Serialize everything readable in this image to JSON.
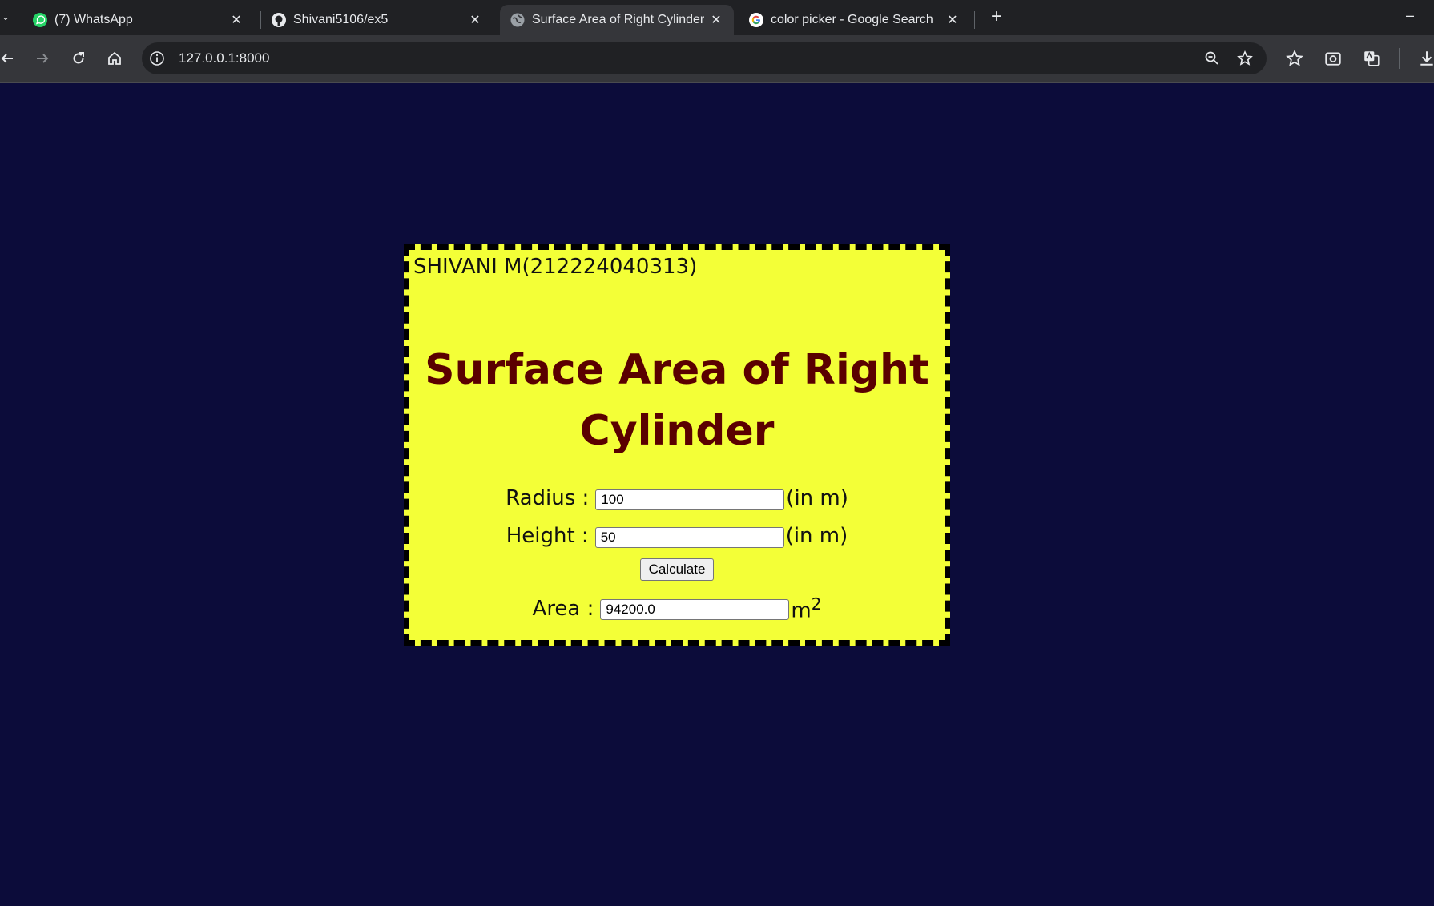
{
  "browser": {
    "tabs": [
      {
        "title": "(7) WhatsApp",
        "icon": "whatsapp-icon",
        "active": false
      },
      {
        "title": "Shivani5106/ex5",
        "icon": "github-icon",
        "active": false
      },
      {
        "title": "Surface Area of Right Cylinder",
        "icon": "globe-icon",
        "active": true
      },
      {
        "title": "color picker - Google Search",
        "icon": "google-icon",
        "active": false
      }
    ],
    "new_tab_label": "+",
    "minimize_label": "–",
    "close_glyph": "✕",
    "url": "127.0.0.1:8000"
  },
  "page": {
    "author": "SHIVANI M(212224040313)",
    "title": "Surface Area of Right Cylinder",
    "radius_label": "Radius :",
    "radius_value": "100",
    "radius_unit": "(in m)",
    "height_label": "Height :",
    "height_value": "50",
    "height_unit": "(in m)",
    "calculate_label": "Calculate",
    "area_label": "Area :",
    "area_value": "94200.0",
    "area_unit": "m",
    "area_unit_exponent": "2"
  },
  "colors": {
    "page_background": "#0c0c3a",
    "card_background": "#f3ff37",
    "title_color": "#5a0000",
    "border_color": "#000000"
  }
}
